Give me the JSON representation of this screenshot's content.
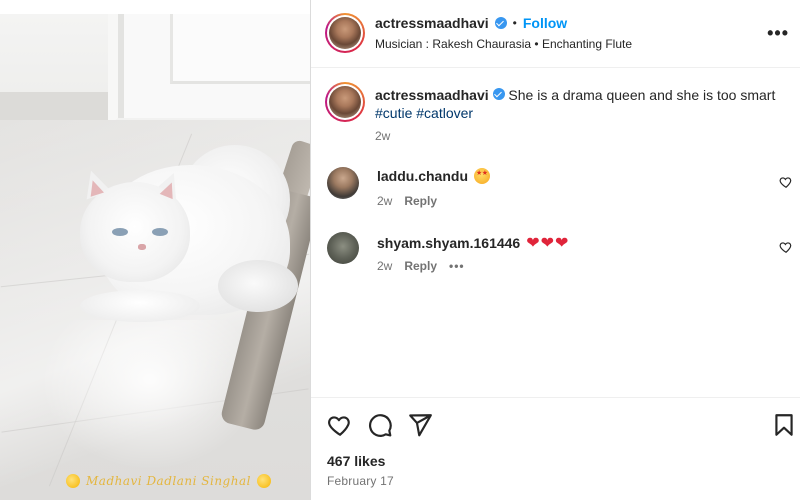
{
  "post": {
    "author": "actressmaadhavi",
    "follow_label": "Follow",
    "separator": "•",
    "music": "Musician : Rakesh Chaurasia • Enchanting Flute",
    "more_label": "•••",
    "image_watermark": "Madhavi Dadlani Singhal",
    "caption_author": "actressmaadhavi",
    "caption_text": "She is a drama queen and she is too smart",
    "hashtags": [
      "#cutie",
      "#catlover"
    ],
    "caption_time": "2w",
    "likes": "467 likes",
    "date": "February 17"
  },
  "comments": [
    {
      "user": "laddu.chandu",
      "emoji": "star-struck",
      "time": "2w",
      "reply_label": "Reply"
    },
    {
      "user": "shyam.shyam.161446",
      "hearts": "❤❤❤",
      "time": "2w",
      "reply_label": "Reply",
      "more_label": "•••"
    }
  ],
  "icons": {
    "like": "heart-outline-icon",
    "comment": "comment-icon",
    "share": "paper-plane-icon",
    "save": "bookmark-icon",
    "verified": "verified-badge-icon",
    "more": "more-options-icon"
  },
  "colors": {
    "accent": "#0095f6",
    "verified": "#3897f0",
    "hashtag": "#00376b",
    "heart_emoji": "#e0243a"
  }
}
